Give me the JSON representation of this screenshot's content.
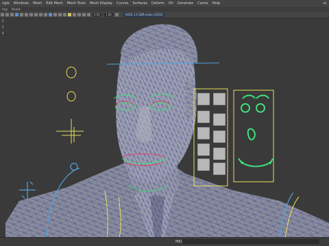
{
  "menubar": {
    "items": [
      "ngle",
      "Windows",
      "Mesh",
      "Edit Mesh",
      "Mesh Tools",
      "Mesh Display",
      "Curves",
      "Surfaces",
      "Deform",
      "UV",
      "Generate",
      "Cache",
      "Help"
    ],
    "right_label": "ul"
  },
  "panel_menu": {
    "items": [
      "ting",
      "Panels"
    ]
  },
  "toolbar": {
    "field_a": "0.00",
    "field_b": "1.00",
    "camera_label": "ACES 1.0 SDR-video (ACES)"
  },
  "left_tools": [
    "2",
    "3",
    "4"
  ],
  "status": {
    "mel_label": "MEL"
  },
  "colors": {
    "background": "#3a3a3a",
    "wire": "#1e2a8c",
    "mesh": "#8d8fa0",
    "control_yellow": "#e6e05a",
    "control_green": "#3fe07a",
    "control_red": "#e0406b",
    "control_blue": "#4fa4e0"
  }
}
